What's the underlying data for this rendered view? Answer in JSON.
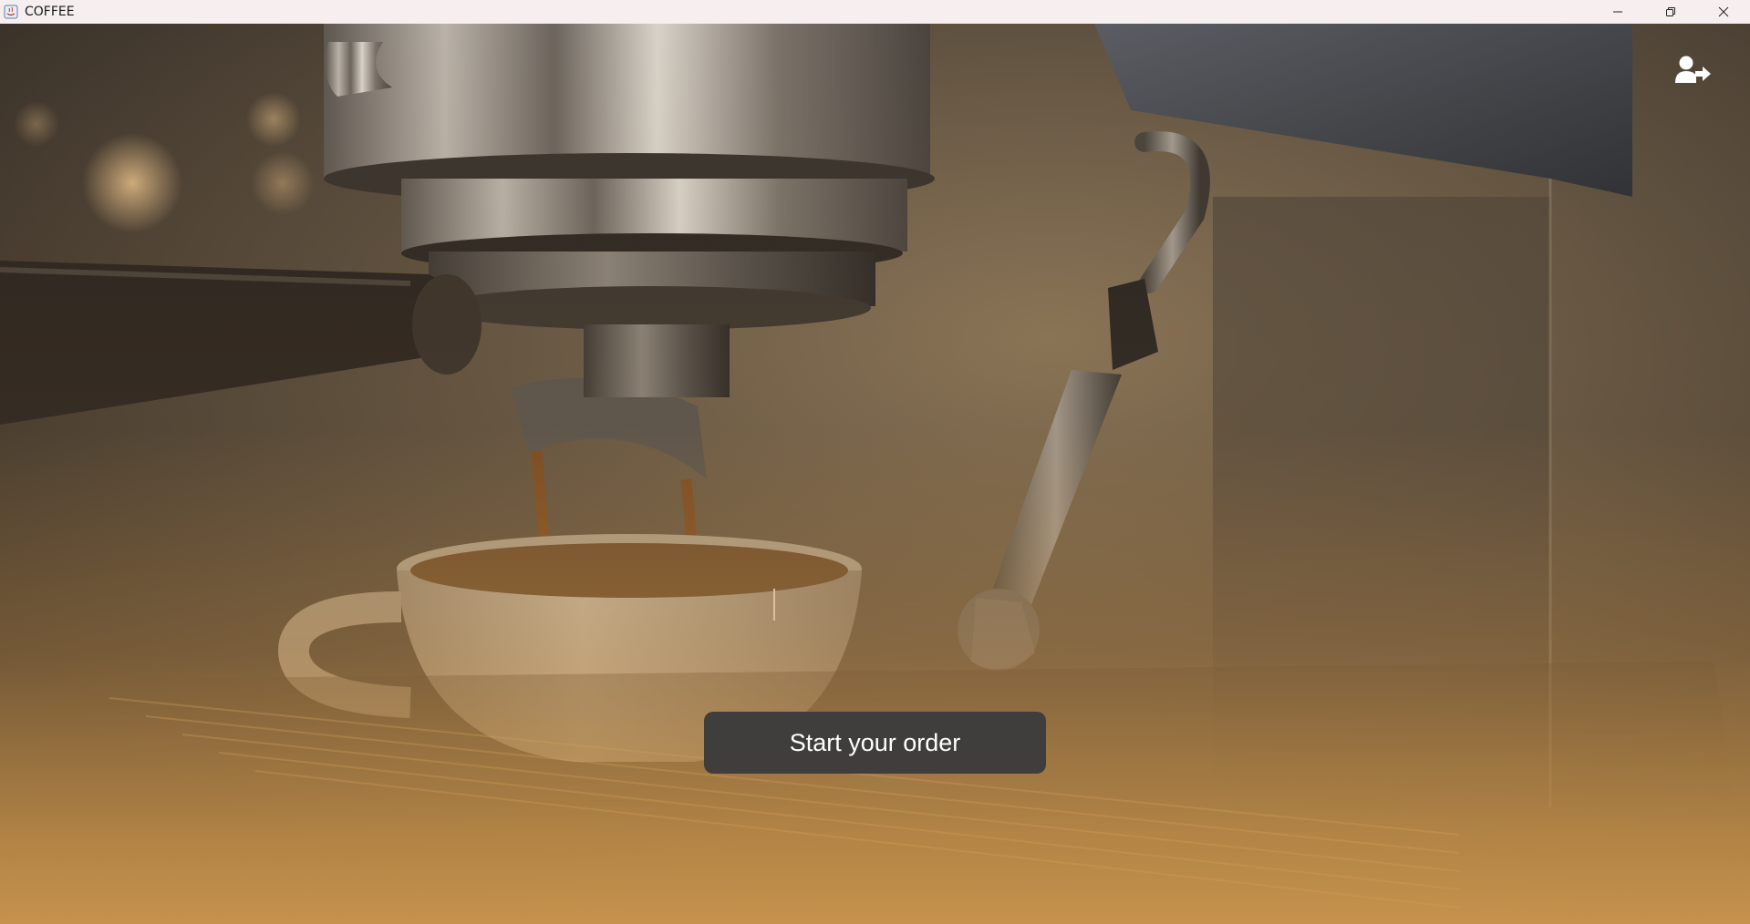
{
  "window": {
    "title": "COFFEE",
    "controls": [
      "minimize-icon",
      "restore-icon",
      "close-icon"
    ]
  },
  "header": {
    "user_action_icon": "user-plus-arrow-icon"
  },
  "main": {
    "background": "espresso-machine-photo",
    "start_button_label": "Start your order"
  },
  "colors": {
    "titlebar_bg": "#f7eef0",
    "button_bg": "#3f3e3d",
    "button_text": "#ffffff",
    "accent_amber": "#d29b50"
  }
}
